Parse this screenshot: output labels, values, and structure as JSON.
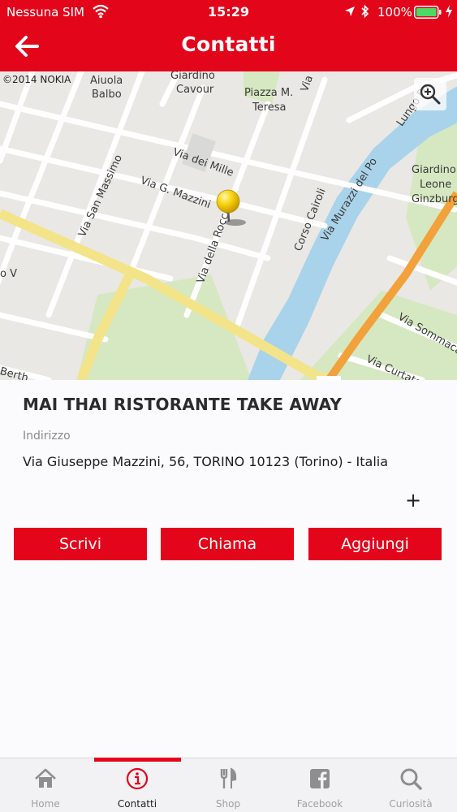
{
  "status_bar": {
    "carrier": "Nessuna SIM",
    "time": "15:29",
    "battery": "100%"
  },
  "nav": {
    "title": "Contatti",
    "back_icon": "arrow-left-icon"
  },
  "map": {
    "copyright": "©2014 NOKIA",
    "labels": [
      "Aiuola",
      "Balbo",
      "Giardino",
      "Cavour",
      "Piazza M.",
      "Teresa",
      "Via dei Mille",
      "Via G. Mazzini",
      "Via San Massimo",
      "Via della Rocca",
      "Corso Cairoli",
      "Via Murazzi del Po",
      "Giardino",
      "Leone",
      "Ginzburg",
      "Via Sommacampagna",
      "Via Curtatone",
      "Lungo Po",
      "Via",
      "o V",
      "Berth"
    ]
  },
  "place": {
    "name": "MAI THAI RISTORANTE TAKE AWAY",
    "address_label": "Indirizzo",
    "address": "Via Giuseppe Mazzini, 56, TORINO 10123 (Torino) - Italia",
    "expand": "+"
  },
  "actions": {
    "write": "Scrivi",
    "call": "Chiama",
    "add": "Aggiungi"
  },
  "tabs": [
    {
      "label": "Home",
      "icon": "home-icon"
    },
    {
      "label": "Contatti",
      "icon": "info-icon",
      "active": true
    },
    {
      "label": "Shop",
      "icon": "fork-knife-icon"
    },
    {
      "label": "Facebook",
      "icon": "facebook-icon"
    },
    {
      "label": "Curiosità",
      "icon": "search-icon"
    }
  ],
  "colors": {
    "brand": "#e3061b",
    "text_dark": "#2b2b2b",
    "muted": "#8a8a8a",
    "tab_inactive": "#a0a0a0",
    "river": "#a9d3ea",
    "park": "#d6e8c2",
    "major_road": "#f3e48a",
    "highway": "#f2a13b"
  }
}
